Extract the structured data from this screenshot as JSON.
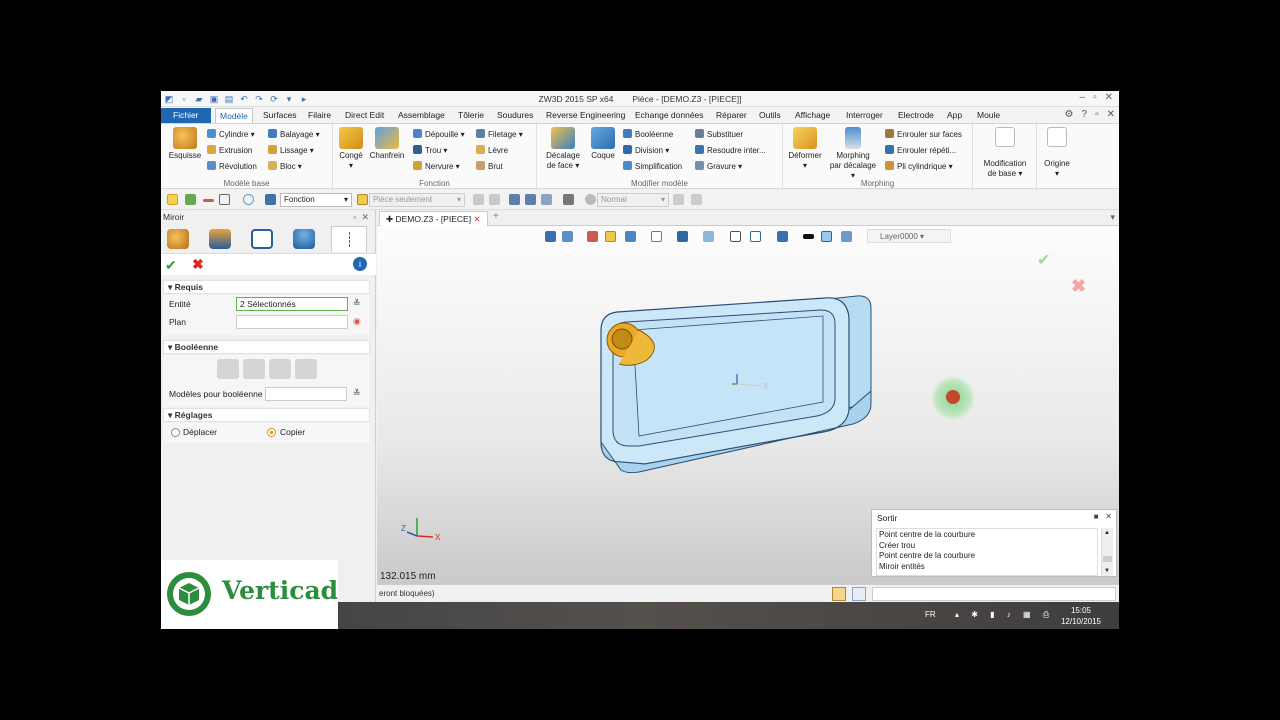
{
  "window": {
    "app_title": "ZW3D 2015 SP x64",
    "doc_title": "Pièce - [DEMO.Z3 - [PIECE]]"
  },
  "menu": {
    "file": "Fichier",
    "tabs": [
      "Modèle",
      "Surfaces",
      "Filaire",
      "Direct Edit",
      "Assemblage",
      "Tôlerie",
      "Soudures",
      "Reverse Engineering",
      "Echange données",
      "Réparer",
      "Outils",
      "Affichage",
      "Interroger",
      "Electrode",
      "App",
      "Moule"
    ]
  },
  "ribbon": {
    "modele_base": {
      "label": "Modèle base",
      "esquisse": "Esquisse",
      "items": [
        "Cylindre",
        "Extrusion",
        "Révolution",
        "Balayage",
        "Lissage",
        "Bloc"
      ]
    },
    "fonction": {
      "label": "Fonction",
      "conge": "Congé",
      "chanfrein": "Chanfrein",
      "items": [
        "Dépouille",
        "Trou",
        "Nervure",
        "Filetage",
        "Lèvre",
        "Brut"
      ]
    },
    "modifier": {
      "label": "Modifier modèle",
      "decalage_1": "Décalage",
      "decalage_2": "de face",
      "coque": "Coque",
      "items": [
        "Booléenne",
        "Division",
        "Simplification",
        "Substituer",
        "Resoudre inter...",
        "Gravure"
      ]
    },
    "morphing": {
      "label": "Morphing",
      "deformer": "Déformer",
      "morph_1": "Morphing",
      "morph_2": "par décalage",
      "items": [
        "Enrouler sur faces",
        "Enrouler répéti...",
        "Pli cylindrique"
      ]
    },
    "modif_base_1": "Modification",
    "modif_base_2": "de base",
    "origine": "Origine"
  },
  "toolbar": {
    "filter": "Fonction",
    "scope": "Pièce seulement",
    "mode": "Normal"
  },
  "left_panel": {
    "title": "Miroir",
    "requis": {
      "header": "Requis",
      "entite_label": "Entité",
      "entite_value": "2 Sélectionnés",
      "plan_label": "Plan"
    },
    "booleenne": {
      "header": "Booléenne",
      "modeles_label": "Modèles pour booléenne"
    },
    "reglages": {
      "header": "Réglages",
      "deplacer": "Déplacer",
      "copier": "Copier"
    }
  },
  "document": {
    "tab": "DEMO.Z3 - [PIECE]",
    "layer": "Layer0000",
    "measure": "132.015 mm"
  },
  "output": {
    "title": "Sortir",
    "lines": [
      "Point centre de la courbure",
      "Créer trou",
      "Point centre de la courbure",
      "Miroir entités"
    ]
  },
  "status": {
    "text": "eront bloquées)"
  },
  "taskbar": {
    "lang": "FR",
    "time": "15:05",
    "date": "12/10/2015"
  },
  "logo": {
    "text": "Verticad"
  },
  "colors": {
    "accent": "#1f66b3",
    "part_fill": "#c9e6f7",
    "part_edge": "#2b4f72",
    "highlight": "#e2a21a",
    "logo_green": "#2c8d3c"
  }
}
